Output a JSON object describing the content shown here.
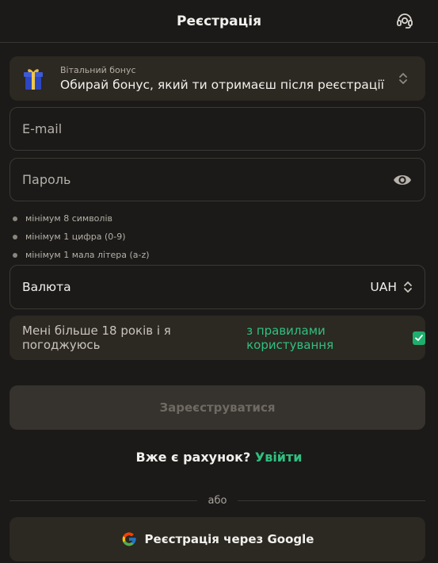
{
  "header": {
    "title": "Реєстрація",
    "support_icon": "headset-icon"
  },
  "bonus": {
    "label": "Вітальний бонус",
    "value": "Обирай бонус, який ти отримаєш після реєстрації",
    "icon": "gift-icon"
  },
  "email": {
    "placeholder": "E-mail"
  },
  "password": {
    "placeholder": "Пароль",
    "icon": "eye-icon"
  },
  "password_rules": [
    "мінімум 8 символів",
    "мінімум 1 цифра (0-9)",
    "мінімум 1 мала літера (a-z)"
  ],
  "currency": {
    "label": "Валюта",
    "value": "UAH"
  },
  "agreement": {
    "text": "Мені більше 18 років і я погоджуюсь",
    "link": "з правилами користування",
    "checked": true
  },
  "submit": {
    "label": "Зареєструватися"
  },
  "login": {
    "question": "Вже є рахунок?",
    "link": "Увійти"
  },
  "divider": {
    "label": "або"
  },
  "google": {
    "label": "Реєстрація через Google"
  },
  "colors": {
    "accent": "#2fc17f",
    "background": "#1b1a19",
    "panel": "#2c2822",
    "button_disabled": "#36322d"
  }
}
